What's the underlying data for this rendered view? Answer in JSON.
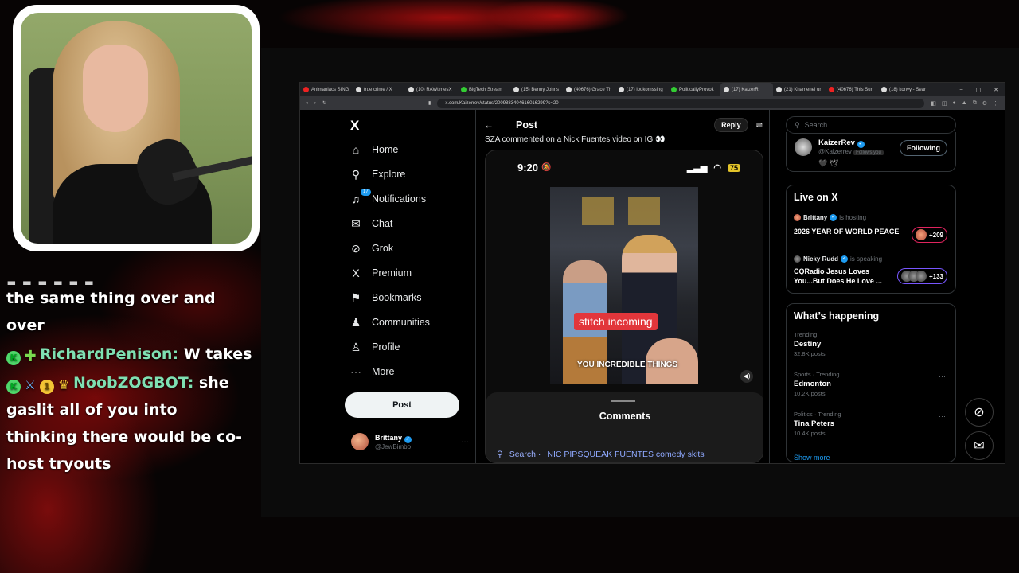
{
  "browser": {
    "tabs": [
      {
        "label": "Animaniacs SING",
        "color": "#e22"
      },
      {
        "label": "true crime / X",
        "color": "#ddd"
      },
      {
        "label": "(10) RAWtimesX",
        "color": "#ddd"
      },
      {
        "label": "BigTech Stream",
        "color": "#3c3"
      },
      {
        "label": "(15) Benny Johns",
        "color": "#ddd"
      },
      {
        "label": "(40676) Grace Th",
        "color": "#ddd"
      },
      {
        "label": "(17) lookomssing",
        "color": "#ddd"
      },
      {
        "label": "PoliticallyProvok",
        "color": "#3c3"
      },
      {
        "label": "(17) KaizerR",
        "color": "#ddd"
      },
      {
        "label": "(21) Khamenei ur",
        "color": "#ddd"
      },
      {
        "label": "(40676) This Sun",
        "color": "#e22"
      },
      {
        "label": "(18) konvy - Sear",
        "color": "#ddd"
      }
    ],
    "url": "x.com/Kaizerrev/status/2009883404616016299?s=20"
  },
  "nav": {
    "logo": "X",
    "notif_count": "17",
    "items": [
      {
        "label": "Home",
        "icon": "home-icon",
        "glyph": "⌂"
      },
      {
        "label": "Explore",
        "icon": "search-icon",
        "glyph": "⚲"
      },
      {
        "label": "Notifications",
        "icon": "bell-icon",
        "glyph": "♫"
      },
      {
        "label": "Chat",
        "icon": "mail-icon",
        "glyph": "✉"
      },
      {
        "label": "Grok",
        "icon": "grok-icon",
        "glyph": "⊘"
      },
      {
        "label": "Premium",
        "icon": "x-premium-icon",
        "glyph": "X"
      },
      {
        "label": "Bookmarks",
        "icon": "bookmark-icon",
        "glyph": "⚑"
      },
      {
        "label": "Communities",
        "icon": "people-icon",
        "glyph": "♟"
      },
      {
        "label": "Profile",
        "icon": "person-icon",
        "glyph": "♙"
      },
      {
        "label": "More",
        "icon": "more-icon",
        "glyph": "⋯"
      }
    ],
    "post_button": "Post",
    "account": {
      "name": "Brittany",
      "handle": "@JewBimbo"
    }
  },
  "post": {
    "header": "Post",
    "reply_button": "Reply",
    "text": "SZA commented on a Nick Fuentes video on IG 👀",
    "phone_time": "9:20",
    "battery": "75",
    "sticker": "stitch incoming",
    "caption": "YOU INCREDIBLE THINGS",
    "comments_title": "Comments",
    "search_suggestion_prefix": "Search ·",
    "search_suggestion_query": "NIC PIPSQUEAK FUENTES comedy skits"
  },
  "right": {
    "search_placeholder": "Search",
    "follow_card": {
      "name": "KaizerRev",
      "handle": "@Kaizerrev",
      "follows_you": "Follows you",
      "button": "Following",
      "emojis": "🖤 🕊"
    },
    "live_title": "Live on X",
    "live": [
      {
        "host": "Brittany",
        "status": "is hosting",
        "title": "2026 YEAR OF WORLD PEACE",
        "count": "+209",
        "border": "#e0245e"
      },
      {
        "host": "Nicky Rudd",
        "status": "is speaking",
        "title": "CQRadio Jesus Loves You...But Does He Love ...",
        "count": "+133",
        "border": "#7856ff"
      }
    ],
    "happening_title": "What’s happening",
    "trends": [
      {
        "category": "Trending",
        "name": "Destiny",
        "count": "32.8K posts"
      },
      {
        "category": "Sports · Trending",
        "name": "Edmonton",
        "count": "10.2K posts"
      },
      {
        "category": "Politics · Trending",
        "name": "Tina Peters",
        "count": "10.4K posts"
      }
    ],
    "show_more": "Show more"
  },
  "chat": {
    "line0_partial": "▪ ▪ ▪ ▪ ▪ ▪",
    "line0_rest": "the same thing over and over",
    "msg1_user": "RichardPenison:",
    "msg1_text": "W takes",
    "msg2_user": "NoobZOGBOT:",
    "msg2_text": "she gaslit all of you into thinking there would be co-host tryouts"
  }
}
